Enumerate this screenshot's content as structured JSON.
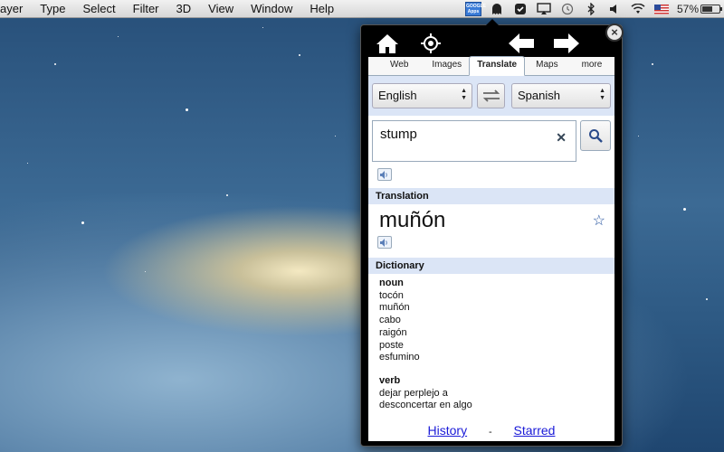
{
  "menubar": {
    "items": [
      "ayer",
      "Type",
      "Select",
      "Filter",
      "3D",
      "View",
      "Window",
      "Help"
    ],
    "app_icon_text": "GOOGLE Apps",
    "battery": "57%"
  },
  "popup": {
    "tabs": [
      {
        "label": "Web"
      },
      {
        "label": "Images"
      },
      {
        "label": "Translate"
      },
      {
        "label": "Maps"
      },
      {
        "label": "more"
      }
    ],
    "source_lang": "English",
    "target_lang": "Spanish",
    "input_value": "stump",
    "translation_header": "Translation",
    "translation": "muñón",
    "dictionary_header": "Dictionary",
    "dictionary": [
      {
        "pos": "noun",
        "terms": [
          "tocón",
          "muñón",
          "cabo",
          "raigón",
          "poste",
          "esfumino"
        ]
      },
      {
        "pos": "verb",
        "terms": [
          "dejar perplejo a",
          "desconcertar en algo"
        ]
      }
    ],
    "history_link": "History",
    "separator": "-",
    "starred_link": "Starred"
  },
  "colors": {
    "accent_header": "#dbe5f6",
    "link": "#1a1ad8"
  }
}
